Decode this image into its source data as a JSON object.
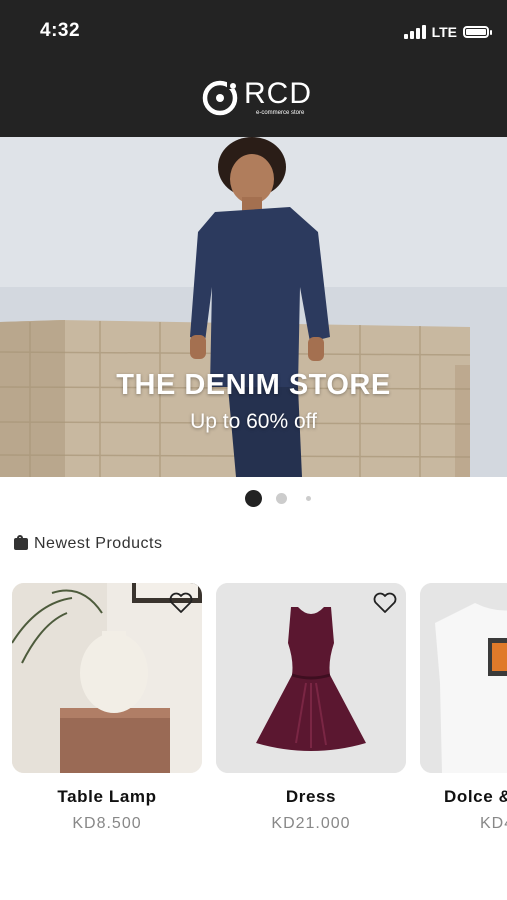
{
  "status_bar": {
    "time": "4:32",
    "network": "LTE"
  },
  "header": {
    "logo_text": "RCD",
    "logo_subtitle": "e-commerce store"
  },
  "banner": {
    "title": "THE DENIM STORE",
    "subtitle": "Up to 60% off",
    "slides": 3,
    "active_slide": 1
  },
  "newest_products": {
    "title": "Newest Products",
    "items": [
      {
        "name": "Table Lamp",
        "price": "KD8.500"
      },
      {
        "name": "Dress",
        "price": "KD21.000"
      },
      {
        "name": "Dolce &",
        "price": "KD4"
      }
    ]
  },
  "colors": {
    "header_bg": "#232323",
    "accent_dark": "#222222",
    "price_text": "#888888",
    "card_bg": "#e5e5e5"
  }
}
